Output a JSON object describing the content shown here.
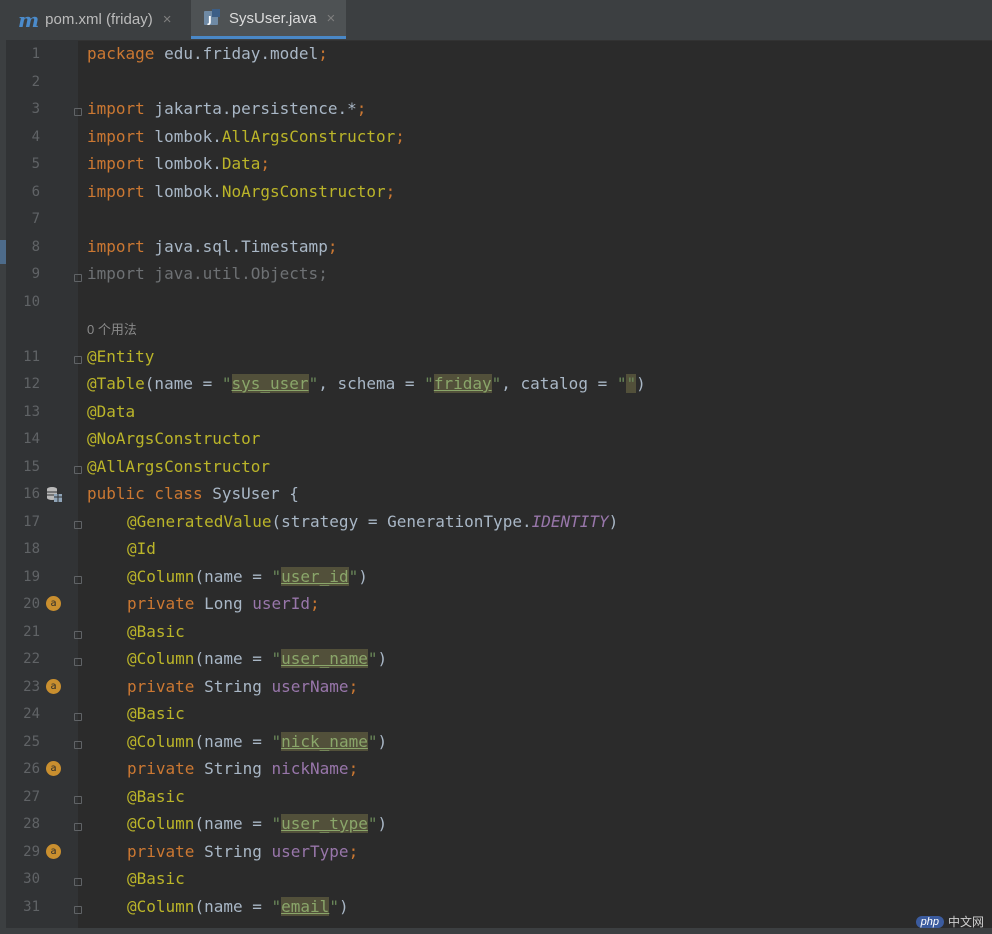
{
  "tabs": [
    {
      "icon": "maven-icon",
      "glyph": "m",
      "label": "pom.xml (friday)",
      "close": "×",
      "active": false
    },
    {
      "icon": "java-class-icon",
      "glyph": "J",
      "label": "SysUser.java",
      "close": "×",
      "active": true
    }
  ],
  "editor": {
    "line_numbers": [
      "1",
      "2",
      "3",
      "4",
      "5",
      "6",
      "7",
      "8",
      "9",
      "10",
      "11",
      "12",
      "13",
      "14",
      "15",
      "16",
      "17",
      "18",
      "19",
      "20",
      "21",
      "22",
      "23",
      "24",
      "25",
      "26",
      "27",
      "28",
      "29",
      "30",
      "31"
    ],
    "usage_hint": "0 个用法",
    "lines": {
      "l1": [
        "package",
        " edu.friday.model",
        ";"
      ],
      "l3": [
        "import",
        " jakarta.persistence.*",
        ";"
      ],
      "l4": [
        "import",
        " lombok.",
        "AllArgsConstructor",
        ";"
      ],
      "l5": [
        "import",
        " lombok.",
        "Data",
        ";"
      ],
      "l6": [
        "import",
        " lombok.",
        "NoArgsConstructor",
        ";"
      ],
      "l8": [
        "import",
        " java.sql.Timestamp",
        ";"
      ],
      "l9": [
        "import java.util.Objects;"
      ],
      "l11": [
        "@Entity"
      ],
      "l12": [
        "@Table",
        "(name = ",
        "\"",
        "sys_user",
        "\"",
        ", schema = ",
        "\"",
        "friday",
        "\"",
        ", catalog = ",
        "\"",
        "\"",
        ")"
      ],
      "l13": [
        "@Data"
      ],
      "l14": [
        "@NoArgsConstructor"
      ],
      "l15": [
        "@AllArgsConstructor"
      ],
      "l16": [
        "public class",
        " SysUser {"
      ],
      "l17": [
        "@GeneratedValue",
        "(strategy = GenerationType.",
        "IDENTITY",
        ")"
      ],
      "l18": [
        "@Id"
      ],
      "l19": [
        "@Column",
        "(name = ",
        "\"",
        "user_id",
        "\"",
        ")"
      ],
      "l20": [
        "private",
        " Long ",
        "userId",
        ";"
      ],
      "l21": [
        "@Basic"
      ],
      "l22": [
        "@Column",
        "(name = ",
        "\"",
        "user_name",
        "\"",
        ")"
      ],
      "l23": [
        "private",
        " String ",
        "userName",
        ";"
      ],
      "l24": [
        "@Basic"
      ],
      "l25": [
        "@Column",
        "(name = ",
        "\"",
        "nick_name",
        "\"",
        ")"
      ],
      "l26": [
        "private",
        " String ",
        "nickName",
        ";"
      ],
      "l27": [
        "@Basic"
      ],
      "l28": [
        "@Column",
        "(name = ",
        "\"",
        "user_type",
        "\"",
        ")"
      ],
      "l29": [
        "private",
        " String ",
        "userType",
        ";"
      ],
      "l30": [
        "@Basic"
      ],
      "l31": [
        "@Column",
        "(name = ",
        "\"",
        "email",
        "\"",
        ")"
      ]
    },
    "gutter_icons": {
      "l16": "database-table-icon",
      "l20": "annotation-key-icon",
      "l20_glyph": "a",
      "l23": "annotation-icon",
      "l23_glyph": "a",
      "l26": "annotation-icon",
      "l26_glyph": "a",
      "l29": "annotation-icon",
      "l29_glyph": "a"
    }
  },
  "watermark": {
    "badge": "php",
    "text": "中文网"
  },
  "colors": {
    "background": "#2b2b2b",
    "gutter": "#313335",
    "keyword": "#cc7832",
    "annotation": "#bbb529",
    "string": "#6a8759",
    "field": "#9876aa",
    "plain": "#a9b7c6",
    "active_tab_underline": "#4a88c7"
  }
}
